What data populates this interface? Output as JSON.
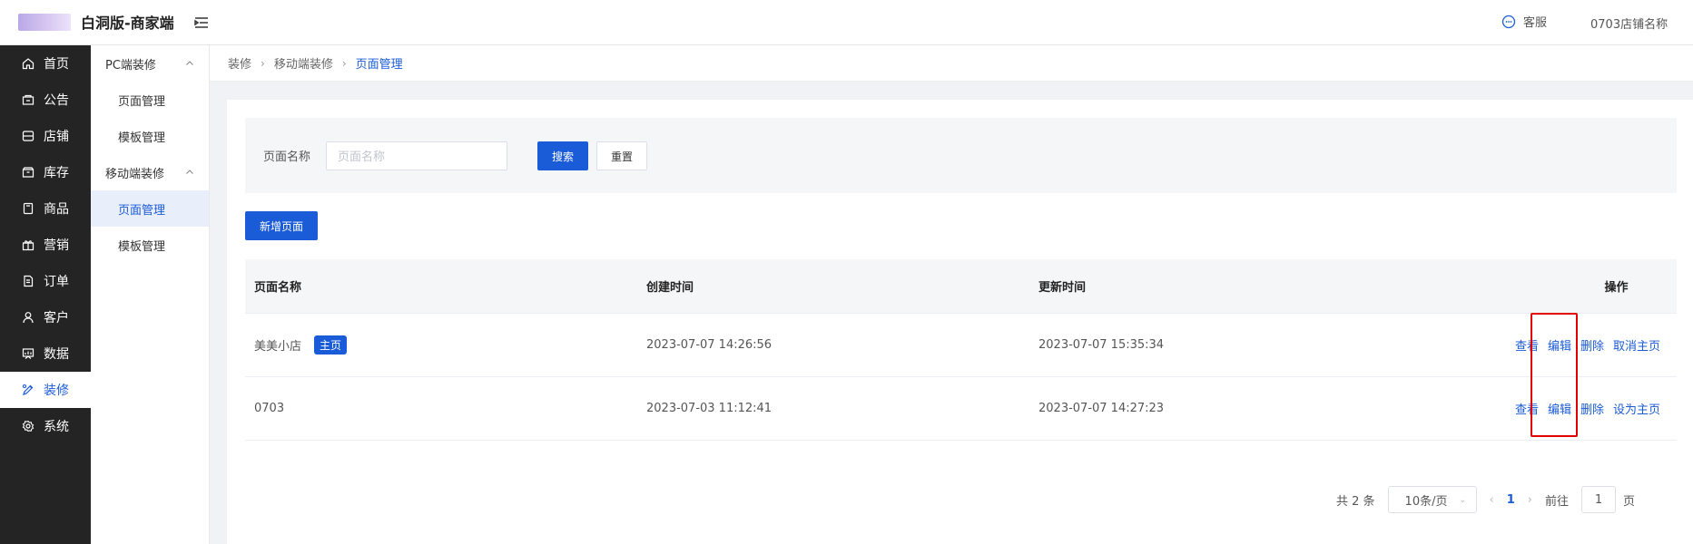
{
  "app": {
    "title": "白洞版-商家端"
  },
  "header": {
    "support_label": "客服",
    "store_name": "0703店铺名称"
  },
  "sidebar": {
    "items": [
      {
        "label": "首页",
        "icon": "home-icon"
      },
      {
        "label": "公告",
        "icon": "notice-icon"
      },
      {
        "label": "店铺",
        "icon": "store-icon"
      },
      {
        "label": "库存",
        "icon": "inventory-icon"
      },
      {
        "label": "商品",
        "icon": "goods-icon"
      },
      {
        "label": "营销",
        "icon": "gift-icon"
      },
      {
        "label": "订单",
        "icon": "order-icon"
      },
      {
        "label": "客户",
        "icon": "user-icon"
      },
      {
        "label": "数据",
        "icon": "chart-icon"
      },
      {
        "label": "装修",
        "icon": "brush-icon",
        "active": true
      },
      {
        "label": "系统",
        "icon": "gear-icon"
      }
    ]
  },
  "subnav": {
    "group1": "PC端装修",
    "group1_items": [
      "页面管理",
      "模板管理"
    ],
    "group2": "移动端装修",
    "group2_items": [
      "页面管理",
      "模板管理"
    ]
  },
  "breadcrumb": [
    "装修",
    "移动端装修",
    "页面管理"
  ],
  "filter": {
    "label": "页面名称",
    "placeholder": "页面名称",
    "search_label": "搜索",
    "reset_label": "重置"
  },
  "add_button": "新增页面",
  "table": {
    "headers": [
      "页面名称",
      "创建时间",
      "更新时间",
      "操作"
    ],
    "rows": [
      {
        "name": "美美小店",
        "tag": "主页",
        "created": "2023-07-07 14:26:56",
        "updated": "2023-07-07 15:35:34",
        "actions": [
          "查看",
          "编辑",
          "删除",
          "取消主页"
        ]
      },
      {
        "name": "0703",
        "tag": "",
        "created": "2023-07-03 11:12:41",
        "updated": "2023-07-07 14:27:23",
        "actions": [
          "查看",
          "编辑",
          "删除",
          "设为主页"
        ]
      }
    ]
  },
  "pager": {
    "total": "共 2 条",
    "page_size": "10条/页",
    "current": "1",
    "goto_label": "前往",
    "goto_value": "1",
    "page_suffix": "页"
  },
  "colors": {
    "primary": "#1a5bd8",
    "sidebar_bg": "#242424",
    "highlight": "#e00000"
  }
}
